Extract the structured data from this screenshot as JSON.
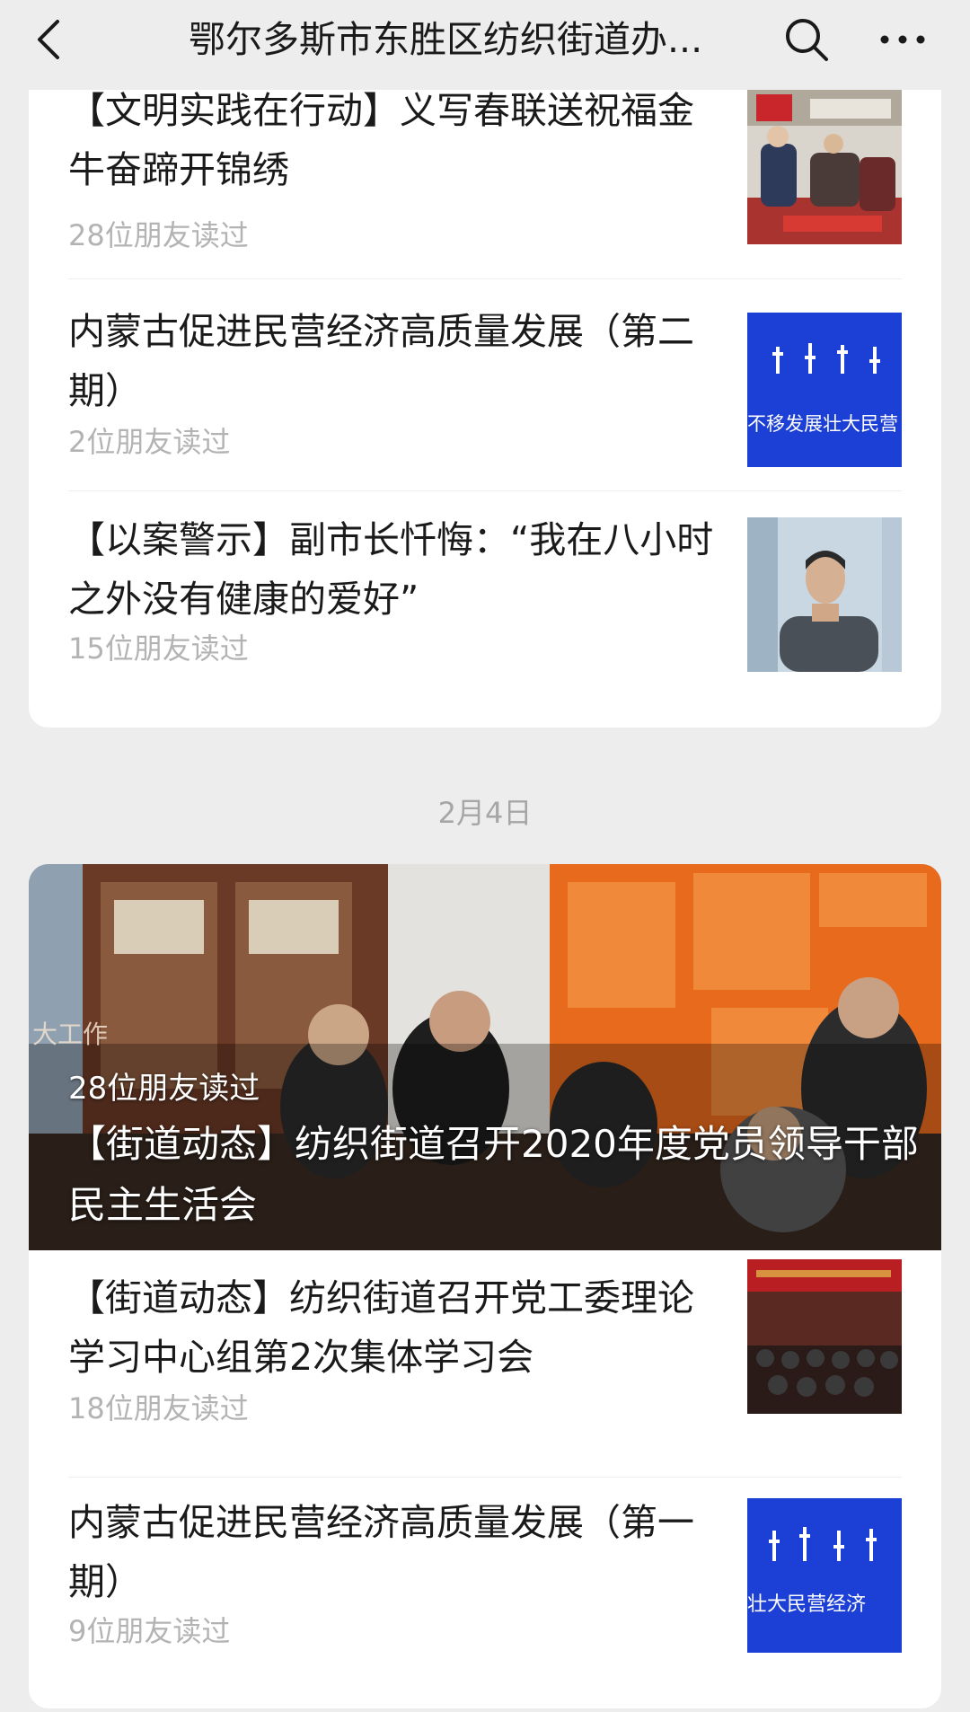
{
  "header": {
    "title": "鄂尔多斯市东胜区纺织街道办..."
  },
  "card1": {
    "items": [
      {
        "title": "【文明实践在行动】义写春联送祝福金牛奋蹄开锦绣",
        "reads": "28位朋友读过"
      },
      {
        "title": "内蒙古促进民营经济高质量发展（第二期）",
        "reads": "2位朋友读过",
        "thumb_text": "不移发展壮大民营"
      },
      {
        "title": "【以案警示】副市长忏悔：“我在八小时之外没有健康的爱好”",
        "reads": "15位朋友读过"
      }
    ]
  },
  "date_label": "2月4日",
  "card2": {
    "hero": {
      "reads": "28位朋友读过",
      "title": "【街道动态】纺织街道召开2020年度党员领导干部民主生活会",
      "banner_text": "大工作"
    },
    "items": [
      {
        "title": "【街道动态】纺织街道召开党工委理论学习中心组第2次集体学习会",
        "reads": "18位朋友读过"
      },
      {
        "title": "内蒙古促进民营经济高质量发展（第一期）",
        "reads": "9位朋友读过",
        "thumb_text": "壮大民营经济"
      }
    ]
  }
}
